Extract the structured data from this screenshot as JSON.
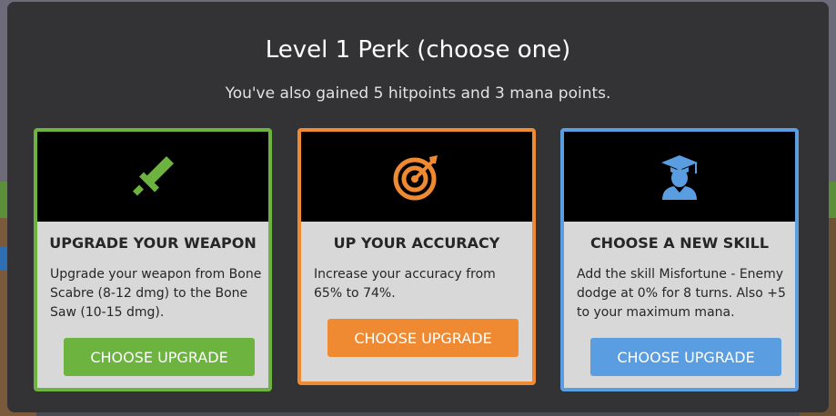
{
  "modal": {
    "title": "Level 1 Perk (choose one)",
    "subtitle": "You've also gained 5 hitpoints and 3 mana points."
  },
  "cards": [
    {
      "icon": "sword-icon",
      "heading": "UPGRADE YOUR WEAPON",
      "description": "Upgrade your weapon from Bone Scabre (8-12 dmg) to the Bone Saw (10-15 dmg).",
      "button": "CHOOSE UPGRADE",
      "color": "#6cb33f"
    },
    {
      "icon": "target-icon",
      "heading": "UP YOUR ACCURACY",
      "description": "Increase your accuracy from 65% to 74%.",
      "button": "CHOOSE UPGRADE",
      "color": "#ef8a32"
    },
    {
      "icon": "graduate-icon",
      "heading": "CHOOSE A NEW SKILL",
      "description": "Add the skill Misfortune - Enemy dodge at 0% for 8 turns. Also +5 to your maximum mana.",
      "button": "CHOOSE UPGRADE",
      "color": "#5a9de0"
    }
  ]
}
